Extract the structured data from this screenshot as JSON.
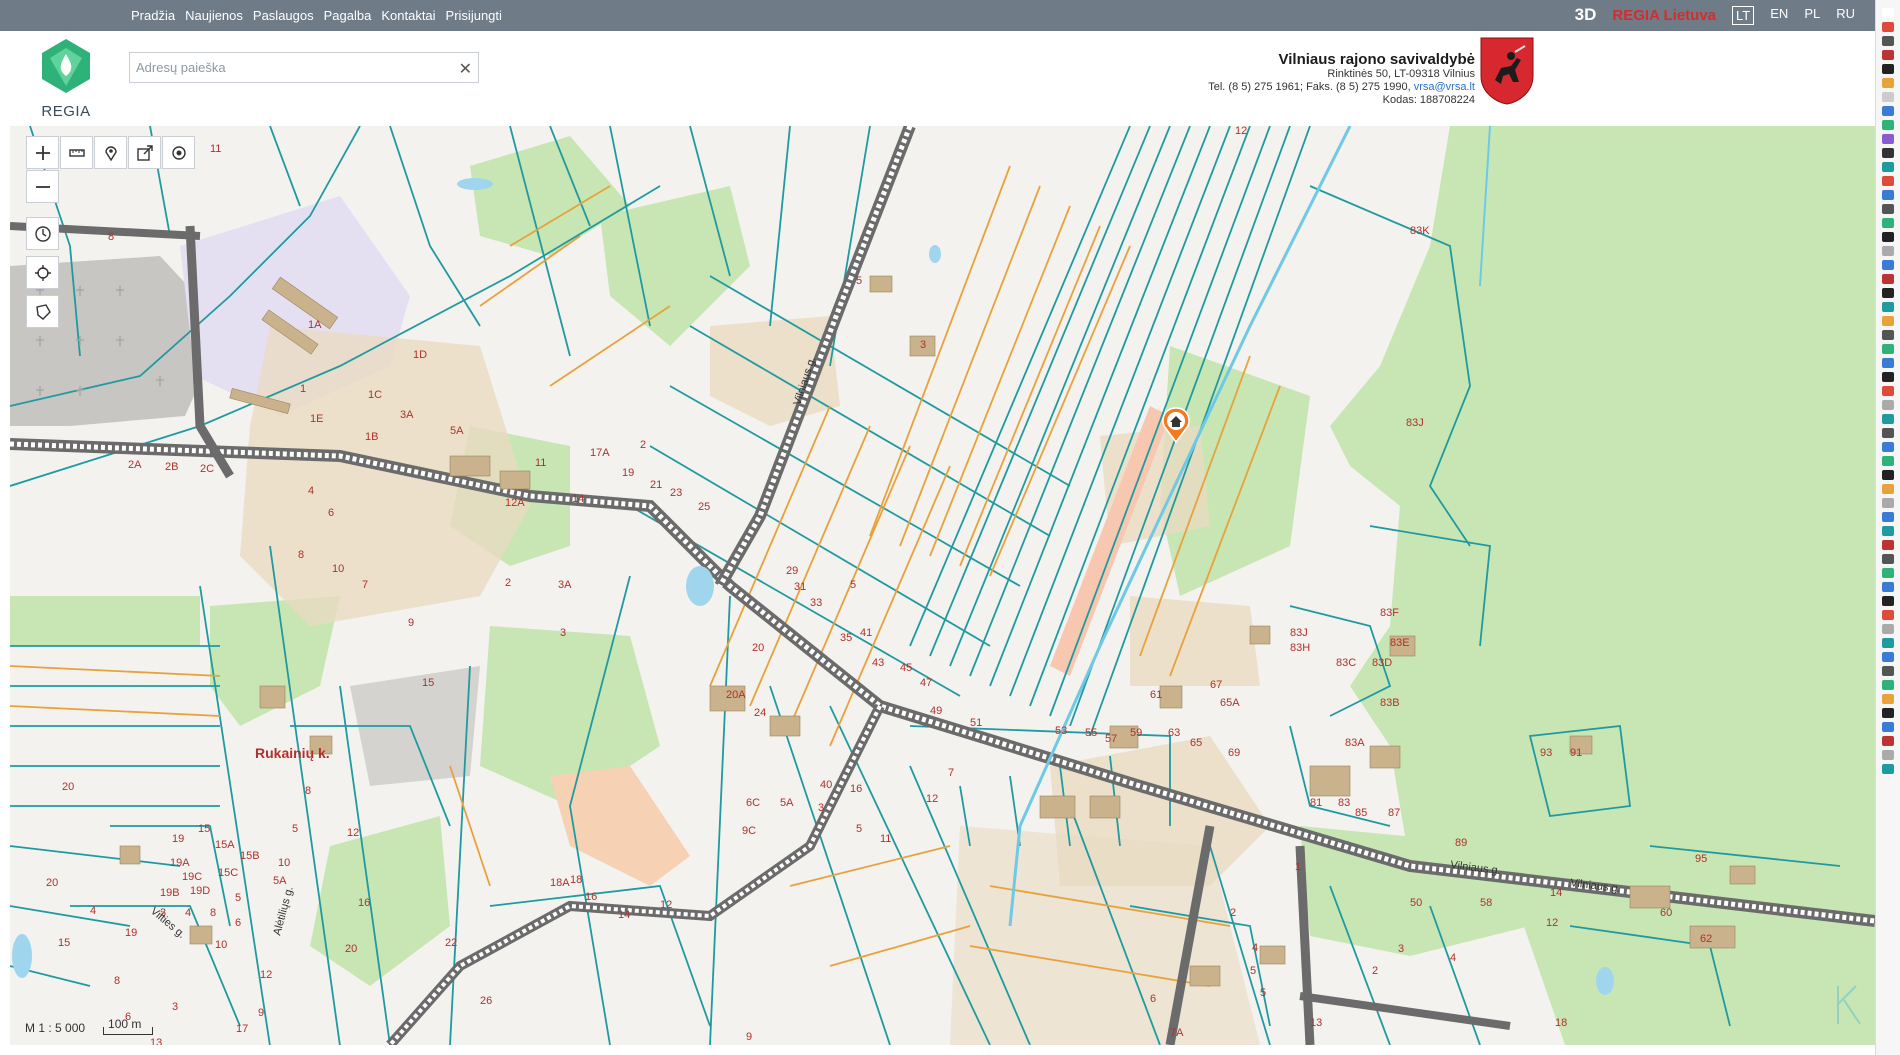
{
  "topbar": {
    "menu": [
      "Pradžia",
      "Naujienos",
      "Paslaugos",
      "Pagalba",
      "Kontaktai",
      "Prisijungti"
    ],
    "btn_3d": "3D",
    "brand": "REGIA Lietuva",
    "langs": [
      "LT",
      "EN",
      "PL",
      "RU"
    ],
    "active_lang": "LT"
  },
  "logo": {
    "word": "REGIA",
    "color": "#2eb27a"
  },
  "search": {
    "placeholder": "Adresų paieška",
    "value": "",
    "clear_icon": "close-icon"
  },
  "municipality": {
    "name": "Vilniaus rajono savivaldybė",
    "address": "Rinktinės 50, LT-09318 Vilnius",
    "phones": "Tel. (8 5) 275 1961; Faks. (8 5) 275 1990,",
    "email": "vrsa@vrsa.lt",
    "code": "Kodas: 188708224"
  },
  "map_tools": {
    "top": [
      {
        "name": "zoom-in-icon"
      },
      {
        "name": "measure-ruler-icon"
      },
      {
        "name": "location-pin-icon"
      },
      {
        "name": "share-export-icon"
      },
      {
        "name": "target-icon"
      }
    ],
    "side": [
      {
        "name": "zoom-out-icon"
      },
      {
        "name": "history-clock-icon"
      },
      {
        "name": "crosshair-icon"
      },
      {
        "name": "polygon-select-icon"
      }
    ]
  },
  "map": {
    "place_name": "Rukainių k.",
    "streets": [
      "Vilniaus g.",
      "Vilties g.",
      "Alėtiliųs g."
    ],
    "parcel_labels": [
      "8",
      "1A",
      "1D",
      "1",
      "1E",
      "1C",
      "3A",
      "5A",
      "1B",
      "2A",
      "2B",
      "2C",
      "4",
      "6",
      "8",
      "10",
      "7",
      "2",
      "9",
      "15",
      "11",
      "12A",
      "14",
      "3A",
      "3",
      "19",
      "17A",
      "2",
      "21",
      "23",
      "25",
      "29",
      "31",
      "33",
      "35",
      "41",
      "20",
      "20A",
      "24",
      "43",
      "45",
      "47",
      "49",
      "51",
      "53",
      "55",
      "57",
      "59",
      "61",
      "63",
      "65",
      "67",
      "69",
      "81",
      "83",
      "83A",
      "83B",
      "83C",
      "83D",
      "83E",
      "83F",
      "83H",
      "83J",
      "83K",
      "85",
      "87",
      "89",
      "91",
      "93",
      "95",
      "58",
      "60",
      "62",
      "50",
      "12",
      "14",
      "18",
      "7A",
      "1",
      "2",
      "3",
      "4",
      "5",
      "6",
      "16",
      "18A",
      "18",
      "14",
      "26",
      "22",
      "20",
      "19",
      "19A",
      "19B",
      "19C",
      "19D",
      "15",
      "15A",
      "15B",
      "15C",
      "5",
      "5A",
      "10",
      "12",
      "12",
      "9",
      "17",
      "6",
      "8",
      "3",
      "13",
      "20",
      "4",
      "40",
      "6C",
      "9C",
      "5A",
      "3",
      "5",
      "11",
      "12",
      "7"
    ],
    "marker": "home-marker-icon"
  },
  "scale": {
    "ratio": "M 1 : 5 000",
    "bar_label": "100 m"
  },
  "colors": {
    "topbar": "#6f7b87",
    "parcel_teal": "#1f9aa0",
    "parcel_orange": "#e8a13b",
    "road_dark": "#555555",
    "green_area": "#c8e6b4",
    "building": "#d7c4a6",
    "label_red": "#b2302a"
  }
}
